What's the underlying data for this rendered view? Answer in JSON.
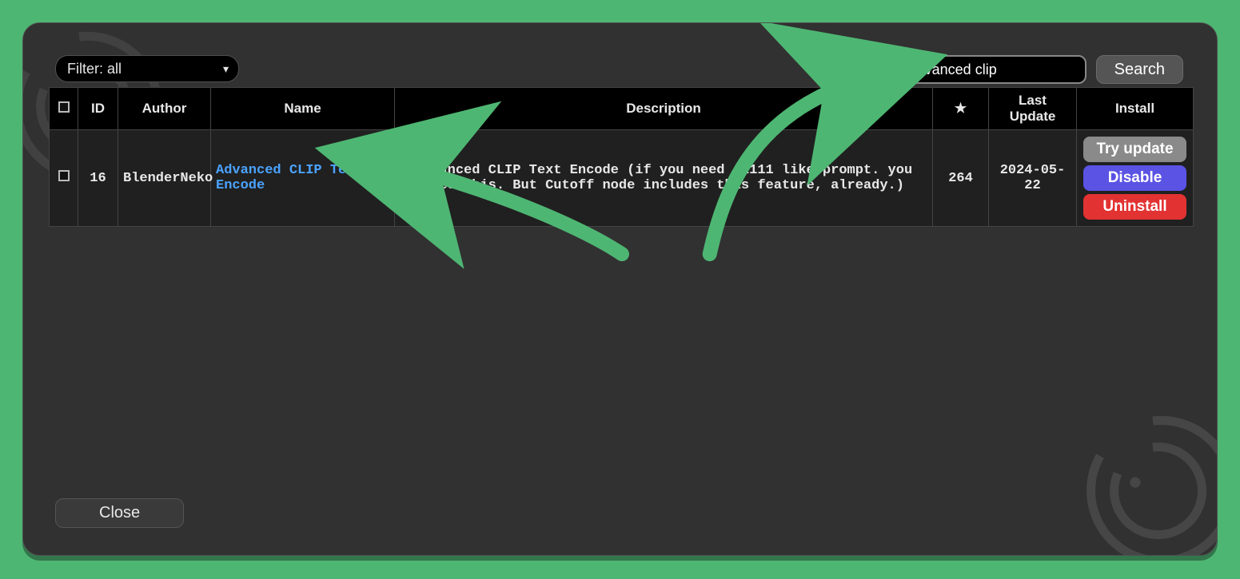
{
  "filter": {
    "label": "Filter: all"
  },
  "search": {
    "value": "advanced clip",
    "button": "Search"
  },
  "columns": {
    "id": "ID",
    "author": "Author",
    "name": "Name",
    "description": "Description",
    "star": "★",
    "last_update": "Last Update",
    "install": "Install"
  },
  "row": {
    "id": "16",
    "author": "BlenderNeko",
    "name": "Advanced CLIP Text Encode",
    "description": "Advanced CLIP Text Encode (if you need A1111 like prompt. you need this. But Cutoff node includes this feature, already.)",
    "stars": "264",
    "last_update": "2024-05-22",
    "buttons": {
      "try": "Try update",
      "disable": "Disable",
      "uninstall": "Uninstall"
    }
  },
  "close": "Close"
}
